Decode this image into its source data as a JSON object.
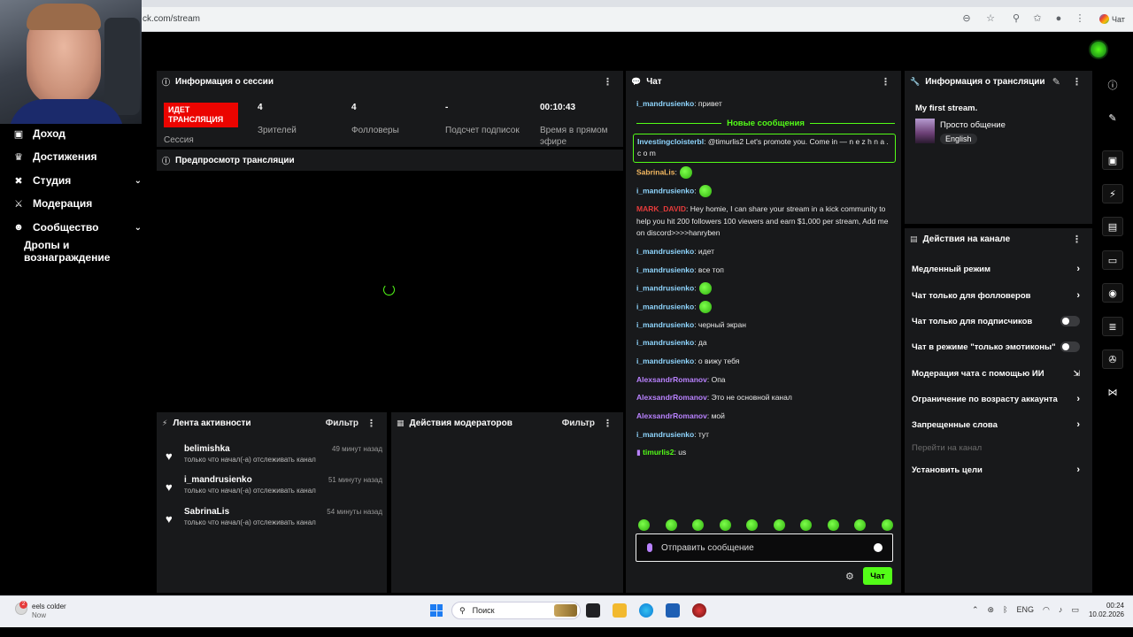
{
  "browser": {
    "url": "ck.com/stream",
    "profile_chip": "Чат"
  },
  "nav": {
    "items": [
      {
        "label": "Доход",
        "icon": "wallet-icon",
        "glyph": "▣"
      },
      {
        "label": "Достижения",
        "icon": "trophy-icon",
        "glyph": "♛"
      },
      {
        "label": "Студия",
        "icon": "tools-icon",
        "glyph": "✖"
      },
      {
        "label": "Модерация",
        "icon": "sword-icon",
        "glyph": "⚔"
      },
      {
        "label": "Сообщество",
        "icon": "users-icon",
        "glyph": "☻"
      }
    ],
    "drops": "Дропы и вознаграждение"
  },
  "session": {
    "title": "Информация о сессии",
    "live_badge": "ИДЕТ ТРАНСЛЯЦИЯ",
    "session_label": "Сессия",
    "stats": [
      {
        "value": "4",
        "label": "Зрителей"
      },
      {
        "value": "4",
        "label": "Фолловеры"
      },
      {
        "value": "-",
        "label": "Подсчет подписок"
      },
      {
        "value": "00:10:43",
        "label": "Время в прямом эфире"
      }
    ]
  },
  "preview": {
    "title": "Предпросмотр трансляции"
  },
  "activity": {
    "title": "Лента активности",
    "filter": "Фильтр",
    "items": [
      {
        "name": "belimishka",
        "time": "49 минут назад",
        "desc": "только что начал(-а) отслеживать канал"
      },
      {
        "name": "i_mandrusienko",
        "time": "51 минуту назад",
        "desc": "только что начал(-а) отслеживать канал"
      },
      {
        "name": "SabrinaLis",
        "time": "54 минуты назад",
        "desc": "только что начал(-а) отслеживать канал"
      }
    ]
  },
  "modactions": {
    "title": "Действия модераторов",
    "filter": "Фильтр"
  },
  "chat": {
    "title": "Чат",
    "new_messages": "Новые сообщения",
    "messages": [
      {
        "user": "i_mandrusienko",
        "text": "привет"
      },
      {
        "user": "Investingcloisterbl",
        "text": "@timurlis2 Let's promote you. Come in — n e z h n a . c o m"
      },
      {
        "user": "SabrinaLis",
        "text": ""
      },
      {
        "user": "i_mandrusienko",
        "text": ""
      },
      {
        "user": "MARK_DAVID",
        "text": "Hey homie, I can share your stream in a kick community to help you hit 200 followers 100 viewers and earn $1,000 per stream, Add me on discord>>>>hanryben"
      },
      {
        "user": "i_mandrusienko",
        "text": "идет"
      },
      {
        "user": "i_mandrusienko",
        "text": "все топ"
      },
      {
        "user": "i_mandrusienko",
        "text": ""
      },
      {
        "user": "i_mandrusienko",
        "text": ""
      },
      {
        "user": "i_mandrusienko",
        "text": "черный экран"
      },
      {
        "user": "i_mandrusienko",
        "text": "да"
      },
      {
        "user": "i_mandrusienko",
        "text": "о вижу тебя"
      },
      {
        "user": "AlexsandrRomanov",
        "text": "Опа"
      },
      {
        "user": "AlexsandrRomanov",
        "text": "Это не основной канал"
      },
      {
        "user": "AlexsandrRomanov",
        "text": "мой"
      },
      {
        "user": "i_mandrusienko",
        "text": "тут"
      },
      {
        "user": "timurlis2",
        "text": "us"
      }
    ],
    "input_placeholder": "Отправить сообщение",
    "send_label": "Чат"
  },
  "stream_info": {
    "title": "Информация о трансляции",
    "stream_title": "My first stream.",
    "category": "Просто общение",
    "language": "English"
  },
  "channel_actions": {
    "title": "Действия на канале",
    "items": [
      {
        "label": "Медленный режим",
        "control": "arrow"
      },
      {
        "label": "Чат только для фолловеров",
        "control": "arrow"
      },
      {
        "label": "Чат только для подписчиков",
        "control": "toggle"
      },
      {
        "label": "Чат в режиме \"только эмотиконы\"",
        "control": "toggle"
      },
      {
        "label": "Модерация чата с помощью ИИ",
        "control": "external"
      },
      {
        "label": "Ограничение по возрасту аккаунта",
        "control": "arrow"
      },
      {
        "label": "Запрещенные слова",
        "control": "arrow"
      },
      {
        "label": "Перейти на канал",
        "control": "none"
      },
      {
        "label": "Установить цели",
        "control": "arrow"
      }
    ]
  },
  "taskbar": {
    "notification": "eels colder",
    "notification_sub": "Now",
    "notification_badge": "2",
    "search": "Поиск",
    "lang": "ENG",
    "time": "00:24",
    "date": "10.02.2026"
  },
  "colors": {
    "accent": "#53fc18",
    "live": "#eb0400",
    "panel": "#18191b"
  }
}
